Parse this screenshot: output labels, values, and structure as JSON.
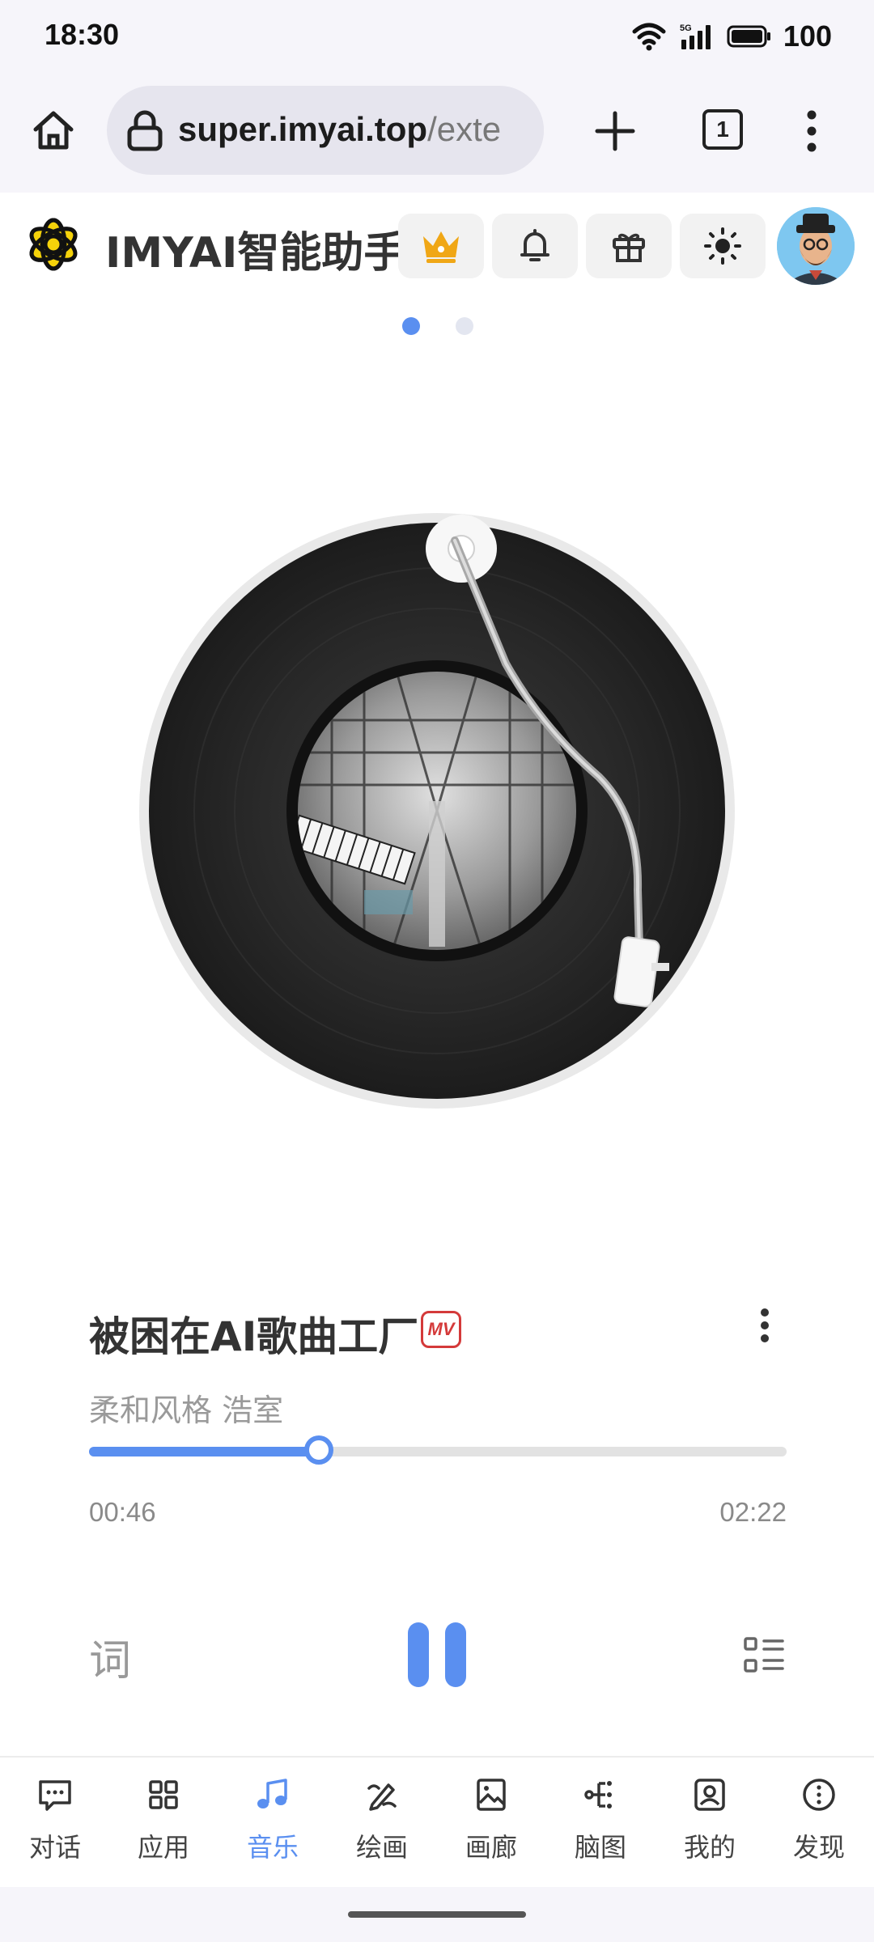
{
  "status_bar": {
    "time": "18:30",
    "network": "5G",
    "battery": "100"
  },
  "browser": {
    "url_bold": "super.imyai.top",
    "url_rest": "/exte",
    "tab_count": "1"
  },
  "app": {
    "title": "IMYAI智能助手",
    "header_buttons": [
      "crown-icon",
      "bell-icon",
      "gift-icon",
      "sun-icon"
    ],
    "accent_color": "#5a8ff0"
  },
  "pager": {
    "pages": 2,
    "active_index": 0
  },
  "player": {
    "song_title": "被困在AI歌曲工厂",
    "mv_badge": "MV",
    "artist_line": "柔和风格 浩室",
    "current_time": "00:46",
    "total_time": "02:22",
    "progress": 0.33,
    "lyrics_label": "词",
    "state": "playing"
  },
  "nav": {
    "items": [
      {
        "label": "对话",
        "icon": "chat-icon"
      },
      {
        "label": "应用",
        "icon": "apps-grid-icon"
      },
      {
        "label": "音乐",
        "icon": "music-note-icon"
      },
      {
        "label": "绘画",
        "icon": "paint-brush-icon"
      },
      {
        "label": "画廊",
        "icon": "gallery-icon"
      },
      {
        "label": "脑图",
        "icon": "mind-map-icon"
      },
      {
        "label": "我的",
        "icon": "profile-icon"
      },
      {
        "label": "发现",
        "icon": "discover-icon"
      }
    ],
    "active_index": 2
  }
}
